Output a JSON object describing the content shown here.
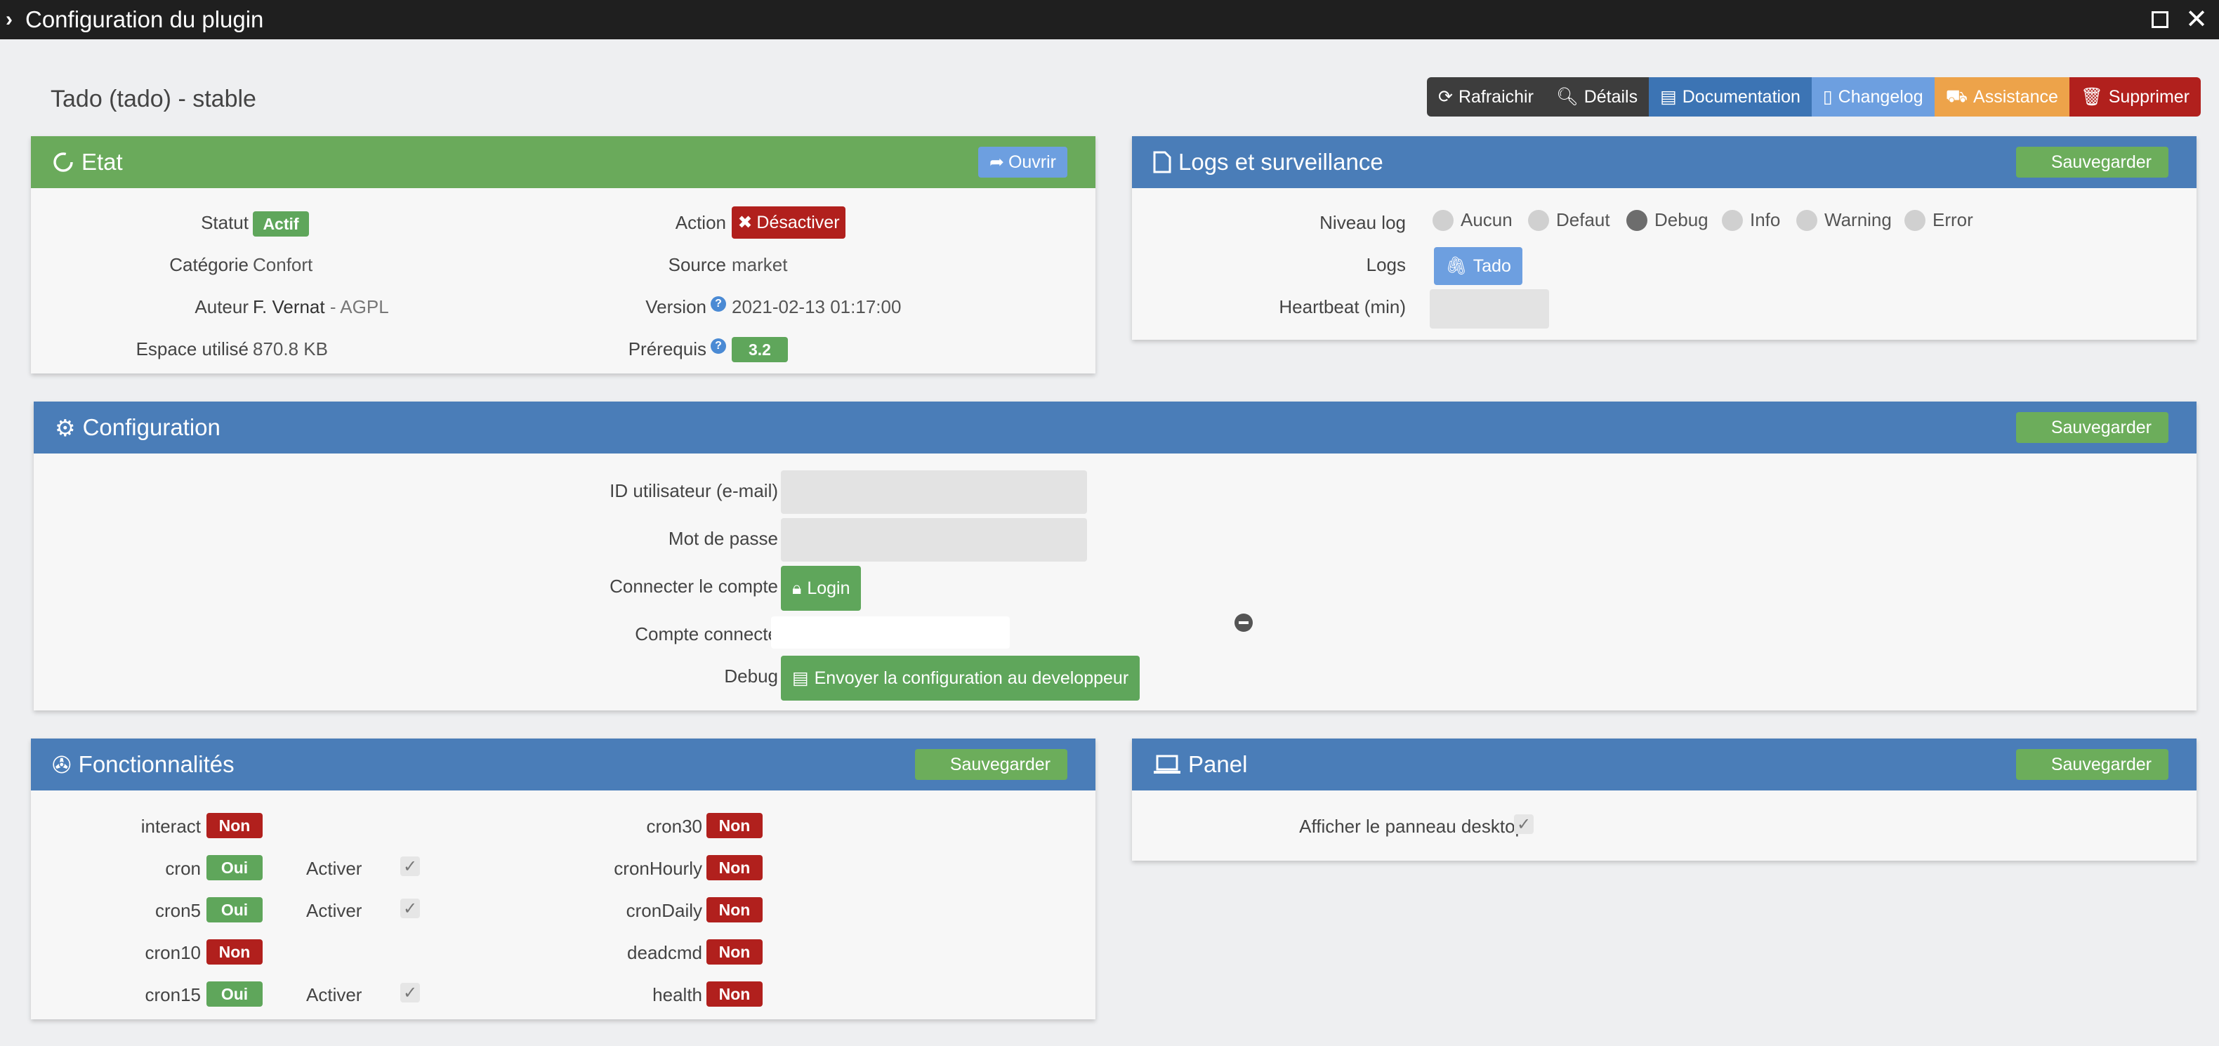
{
  "window": {
    "title": "Configuration du plugin"
  },
  "plugin": {
    "title": "Tado (tado) - stable"
  },
  "toolbar": {
    "refresh": "Rafraichir",
    "details": "Détails",
    "documentation": "Documentation",
    "changelog": "Changelog",
    "assistance": "Assistance",
    "delete": "Supprimer"
  },
  "etat": {
    "title": "Etat",
    "open_label": "Ouvrir",
    "statut_label": "Statut",
    "statut_value": "Actif",
    "categorie_label": "Catégorie",
    "categorie_value": "Confort",
    "auteur_label": "Auteur",
    "auteur_value": "F. Vernat",
    "licence_value": " - AGPL",
    "espace_label": "Espace utilisé",
    "espace_value": "870.8 KB",
    "action_label": "Action",
    "action_button": "Désactiver",
    "source_label": "Source",
    "source_value": "market",
    "version_label": "Version",
    "version_value": "2021-02-13 01:17:00",
    "prerequis_label": "Prérequis",
    "prerequis_value": "3.2"
  },
  "logs": {
    "title": "Logs et surveillance",
    "save_label": "Sauvegarder",
    "niveau_label": "Niveau log",
    "levels": [
      "Aucun",
      "Defaut",
      "Debug",
      "Info",
      "Warning",
      "Error"
    ],
    "selected_level": "Debug",
    "logs_label": "Logs",
    "logs_button": "Tado",
    "heartbeat_label": "Heartbeat (min)"
  },
  "config": {
    "title": "Configuration",
    "save_label": "Sauvegarder",
    "user_label": "ID utilisateur (e-mail)",
    "password_label": "Mot de passe",
    "connect_label": "Connecter le compte",
    "login_button": "Login",
    "connected_label": "Compte connecté",
    "debug_label": "Debug",
    "debug_button": "Envoyer la configuration au developpeur"
  },
  "fonctionnalites": {
    "title": "Fonctionnalités",
    "save_label": "Sauvegarder",
    "activer_label": "Activer",
    "left": [
      {
        "name": "interact",
        "value": "Non",
        "activer": false
      },
      {
        "name": "cron",
        "value": "Oui",
        "activer": true
      },
      {
        "name": "cron5",
        "value": "Oui",
        "activer": true
      },
      {
        "name": "cron10",
        "value": "Non",
        "activer": false
      },
      {
        "name": "cron15",
        "value": "Oui",
        "activer": true
      }
    ],
    "right": [
      {
        "name": "cron30",
        "value": "Non"
      },
      {
        "name": "cronHourly",
        "value": "Non"
      },
      {
        "name": "cronDaily",
        "value": "Non"
      },
      {
        "name": "deadcmd",
        "value": "Non"
      },
      {
        "name": "health",
        "value": "Non"
      }
    ]
  },
  "panel": {
    "title": "Panel",
    "save_label": "Sauvegarder",
    "desktop_label": "Afficher le panneau desktop"
  }
}
